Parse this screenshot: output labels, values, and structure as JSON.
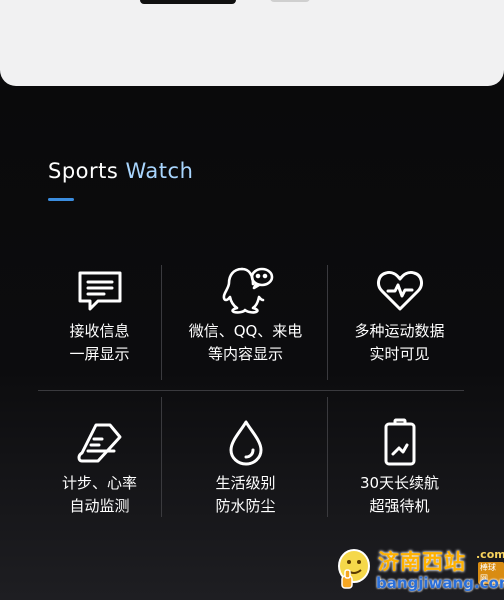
{
  "header": {
    "title_part1": "Sports ",
    "title_part2": "Watch",
    "accent_color": "#3b8ddf",
    "title_accent_color": "#a9d6ff"
  },
  "features": [
    {
      "icon": "message-icon",
      "line1": "接收信息",
      "line2": "一屏显示"
    },
    {
      "icon": "qq-wechat-icon",
      "line1": "微信、QQ、来电",
      "line2": "等内容显示"
    },
    {
      "icon": "heart-rate-icon",
      "line1": "多种运动数据",
      "line2": "实时可见"
    },
    {
      "icon": "shoe-icon",
      "line1": "计步、心率",
      "line2": "自动监测"
    },
    {
      "icon": "water-drop-icon",
      "line1": "生活级别",
      "line2": "防水防尘"
    },
    {
      "icon": "battery-icon",
      "line1": "30天长续航",
      "line2": "超强待机"
    }
  ],
  "watermark": {
    "title": "济南西站",
    "domain": ".com",
    "tag": "棒球网",
    "url": "bangjiwang.com"
  }
}
